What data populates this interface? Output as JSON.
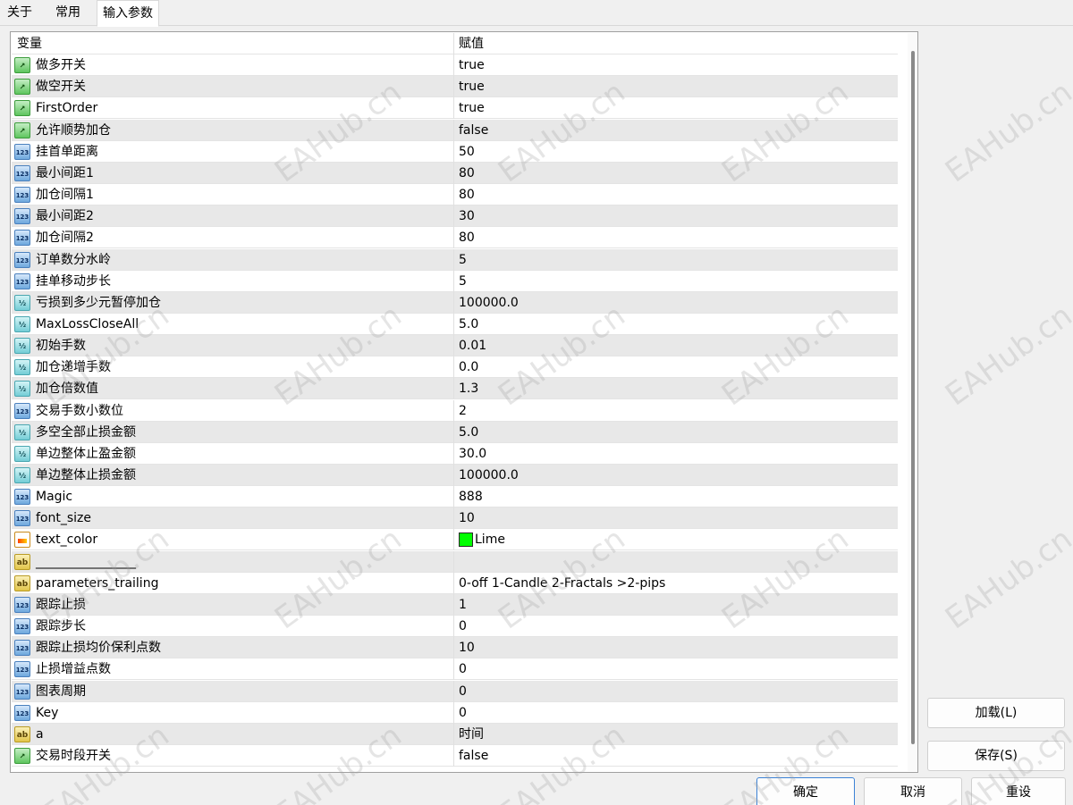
{
  "tabs": [
    "关于",
    "常用",
    "输入参数"
  ],
  "active_tab": "输入参数",
  "table": {
    "header": {
      "name": "变量",
      "value": "赋值"
    },
    "rows": [
      {
        "type": "bool",
        "name": "做多开关",
        "value": "true"
      },
      {
        "type": "bool",
        "name": "做空开关",
        "value": "true"
      },
      {
        "type": "bool",
        "name": "FirstOrder",
        "value": "true"
      },
      {
        "type": "bool",
        "name": "允许顺势加仓",
        "value": "false"
      },
      {
        "type": "int",
        "name": "挂首单距离",
        "value": "50"
      },
      {
        "type": "int",
        "name": "最小间距1",
        "value": "80"
      },
      {
        "type": "int",
        "name": "加仓间隔1",
        "value": "80"
      },
      {
        "type": "int",
        "name": "最小间距2",
        "value": "30"
      },
      {
        "type": "int",
        "name": "加仓间隔2",
        "value": "80"
      },
      {
        "type": "int",
        "name": "订单数分水岭",
        "value": "5"
      },
      {
        "type": "int",
        "name": "挂单移动步长",
        "value": "5"
      },
      {
        "type": "double",
        "name": "亏损到多少元暂停加仓",
        "value": "100000.0"
      },
      {
        "type": "double",
        "name": "MaxLossCloseAll",
        "value": "5.0"
      },
      {
        "type": "double",
        "name": "初始手数",
        "value": "0.01"
      },
      {
        "type": "double",
        "name": "加仓递增手数",
        "value": "0.0"
      },
      {
        "type": "double",
        "name": "加仓倍数值",
        "value": "1.3"
      },
      {
        "type": "int",
        "name": "交易手数小数位",
        "value": "2"
      },
      {
        "type": "double",
        "name": "多空全部止损金额",
        "value": "5.0"
      },
      {
        "type": "double",
        "name": "单边整体止盈金额",
        "value": "30.0"
      },
      {
        "type": "double",
        "name": "单边整体止损金额",
        "value": "100000.0"
      },
      {
        "type": "int",
        "name": "Magic",
        "value": "888"
      },
      {
        "type": "int",
        "name": "font_size",
        "value": "10"
      },
      {
        "type": "color",
        "name": "text_color",
        "value": "Lime",
        "swatch": "#00ff00"
      },
      {
        "type": "string",
        "name": "________________",
        "value": ""
      },
      {
        "type": "string",
        "name": "parameters_trailing",
        "value": "0-off  1-Candle  2-Fractals  >2-pips"
      },
      {
        "type": "int",
        "name": "跟踪止损",
        "value": "1"
      },
      {
        "type": "int",
        "name": "跟踪步长",
        "value": "0"
      },
      {
        "type": "int",
        "name": "跟踪止损均价保利点数",
        "value": "10"
      },
      {
        "type": "int",
        "name": "止损增益点数",
        "value": "0"
      },
      {
        "type": "int",
        "name": "图表周期",
        "value": "0"
      },
      {
        "type": "int",
        "name": "Key",
        "value": "0"
      },
      {
        "type": "string",
        "name": "a",
        "value": "时间"
      },
      {
        "type": "bool",
        "name": "交易时段开关",
        "value": "false"
      }
    ]
  },
  "icon_glyphs": {
    "bool": "↗",
    "int": "123",
    "double": "½",
    "string": "ab",
    "color": ""
  },
  "buttons": {
    "load": "加载(L)",
    "save": "保存(S)",
    "ok": "确定",
    "cancel": "取消",
    "reset": "重设"
  },
  "watermark": "EAHub.cn",
  "colors": {
    "accent": "#3b82d6",
    "row_alt": "#e8e8e8",
    "lime": "#00ff00"
  }
}
